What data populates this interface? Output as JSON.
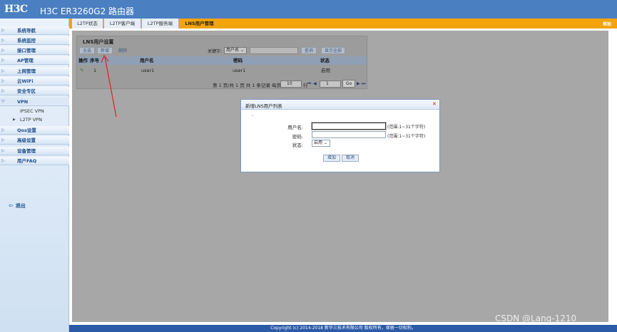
{
  "header": {
    "logo": "H3C",
    "title": "H3C ER3260G2 路由器"
  },
  "sidebar": {
    "items": [
      {
        "label": "系统导航"
      },
      {
        "label": "系统监控"
      },
      {
        "label": "接口管理"
      },
      {
        "label": "AP管理"
      },
      {
        "label": "上网管理"
      },
      {
        "label": "云WiFi"
      },
      {
        "label": "安全专区"
      },
      {
        "label": "VPN",
        "expanded": true,
        "children": [
          {
            "label": "IPSEC VPN"
          },
          {
            "label": "L2TP VPN"
          }
        ]
      },
      {
        "label": "Qos设置"
      },
      {
        "label": "高级设置"
      },
      {
        "label": "设备管理"
      },
      {
        "label": "用户FAQ"
      }
    ],
    "logout": "退出"
  },
  "tabs": [
    {
      "label": "L2TP状态"
    },
    {
      "label": "L2TP客户端"
    },
    {
      "label": "L2TP服务端"
    },
    {
      "label": "LNS用户管理",
      "active": true
    }
  ],
  "help_label": "帮助",
  "panel": {
    "title": "LNS用户设置",
    "toolbar": {
      "select_all": "全选",
      "add": "新增",
      "delete": "删除",
      "keyword_label": "关键字:",
      "keyword_field": "用户名",
      "keyword_value": "",
      "search": "查询",
      "show_all": "显示全部"
    },
    "columns": {
      "op": "操作",
      "index": "序号",
      "username": "用户名",
      "password": "密码",
      "status": "状态"
    },
    "rows": [
      {
        "index": "1",
        "username": "user1",
        "password": "user1",
        "status": "启用"
      }
    ],
    "pager": {
      "summary": "第 1 页/共 1 页 共 1 条记录 每页",
      "per_page": "10",
      "row_label": "行",
      "page": "1",
      "go": "Go"
    }
  },
  "modal": {
    "title": "新增LNS用户列表",
    "dot": ".",
    "username_label": "用户名:",
    "username_value": "",
    "username_hint": "(范围:1~31个字符)",
    "password_label": "密码:",
    "password_value": "",
    "password_hint": "(范围:1~31个字符)",
    "status_label": "状态:",
    "status_value": "启用",
    "add_button": "增加",
    "cancel_button": "取消"
  },
  "footer": "Copyright (c) 2014-2018 新华三技术有限公司 版权所有，保留一切权利。",
  "watermark": "CSDN @Lang-1210",
  "colors": {
    "header": "#4a7fc1",
    "tab_active": "#f4a30a",
    "footer": "#2b5aa6",
    "annotation": "#e0221d"
  }
}
